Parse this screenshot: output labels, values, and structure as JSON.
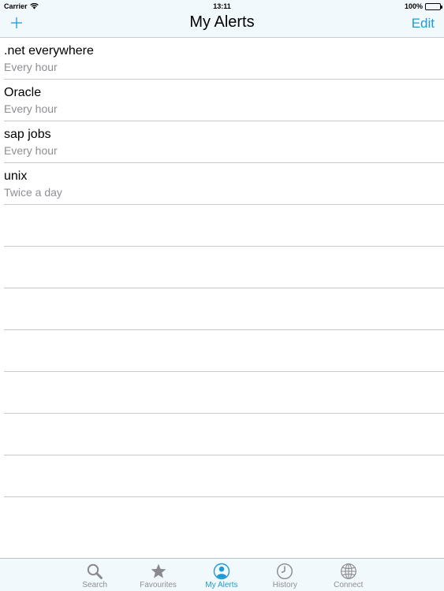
{
  "status_bar": {
    "carrier": "Carrier",
    "time": "13:11",
    "battery": "100%"
  },
  "nav": {
    "title": "My Alerts",
    "edit_label": "Edit",
    "add_icon": "plus-icon"
  },
  "alerts": [
    {
      "title": ".net everywhere",
      "frequency": "Every hour"
    },
    {
      "title": "Oracle",
      "frequency": "Every hour"
    },
    {
      "title": "sap jobs",
      "frequency": "Every hour"
    },
    {
      "title": "unix",
      "frequency": "Twice a day"
    },
    {
      "title": "",
      "frequency": ""
    },
    {
      "title": "",
      "frequency": ""
    },
    {
      "title": "",
      "frequency": ""
    },
    {
      "title": "",
      "frequency": ""
    },
    {
      "title": "",
      "frequency": ""
    },
    {
      "title": "",
      "frequency": ""
    },
    {
      "title": "",
      "frequency": ""
    }
  ],
  "tabs": [
    {
      "label": "Search",
      "icon": "search-icon",
      "active": false
    },
    {
      "label": "Favourites",
      "icon": "star-icon",
      "active": false
    },
    {
      "label": "My Alerts",
      "icon": "person-icon",
      "active": true
    },
    {
      "label": "History",
      "icon": "clock-icon",
      "active": false
    },
    {
      "label": "Connect",
      "icon": "globe-icon",
      "active": false
    }
  ],
  "colors": {
    "accent": "#1e9ad6",
    "bar_background": "#f2f9fc",
    "secondary_text": "#8e8e93"
  }
}
